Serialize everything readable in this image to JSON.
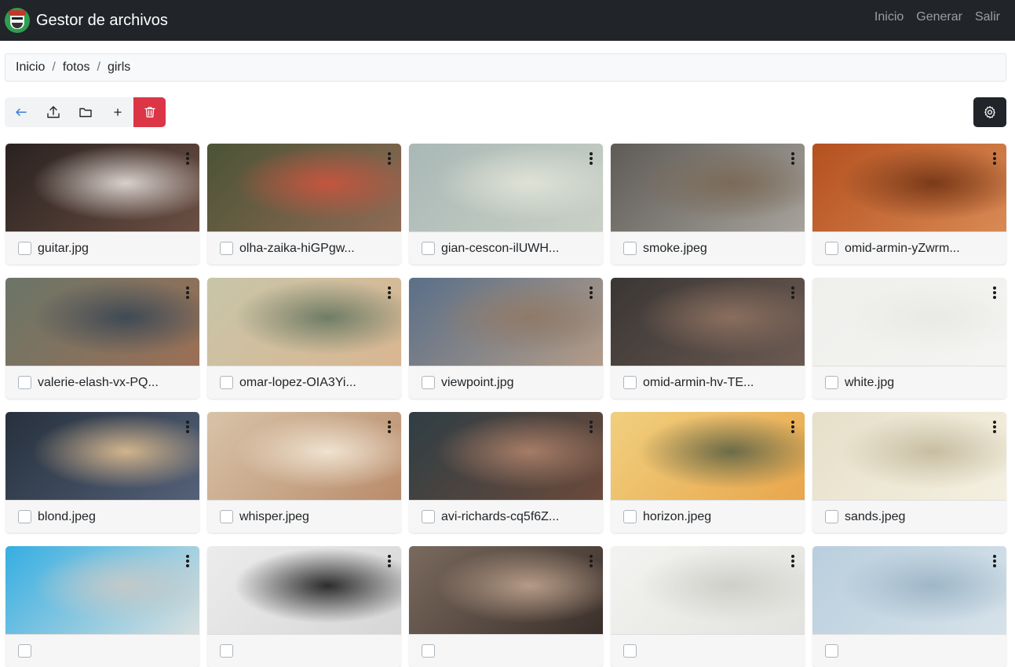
{
  "app": {
    "title": "Gestor de archivos"
  },
  "nav": {
    "links": [
      "Inicio",
      "Generar",
      "Salir"
    ]
  },
  "breadcrumb": [
    "Inicio",
    "fotos",
    "girls"
  ],
  "toolbar": {
    "buttons": [
      "back-arrow-icon",
      "upload-icon",
      "folder-icon",
      "plus-icon",
      "trash-icon"
    ],
    "settings": "gear-icon"
  },
  "files": [
    {
      "name": "guitar.jpg",
      "colors": [
        "#2a2220",
        "#6b4f43",
        "#d8d0cc"
      ]
    },
    {
      "name": "olha-zaika-hiGPgw...",
      "colors": [
        "#4b5336",
        "#8e6b55",
        "#c4553f"
      ]
    },
    {
      "name": "gian-cescon-ilUWH...",
      "colors": [
        "#a9b8b6",
        "#c9d0c6",
        "#dfe2d6"
      ]
    },
    {
      "name": "smoke.jpeg",
      "colors": [
        "#5e5a55",
        "#a7a39c",
        "#7b6a58"
      ]
    },
    {
      "name": "omid-armin-yZwrm...",
      "colors": [
        "#b4501f",
        "#d98a55",
        "#7a3a18"
      ]
    },
    {
      "name": "valerie-elash-vx-PQ...",
      "colors": [
        "#6a7568",
        "#9b6f55",
        "#3f4a55"
      ]
    },
    {
      "name": "omar-lopez-OIA3Yi...",
      "colors": [
        "#c8c5a9",
        "#d9b691",
        "#6f7d66"
      ]
    },
    {
      "name": "viewpoint.jpg",
      "colors": [
        "#5a6f88",
        "#b39c88",
        "#8f7a68"
      ]
    },
    {
      "name": "omid-armin-hv-TE...",
      "colors": [
        "#3a3634",
        "#6b5a52",
        "#8a6e5e"
      ]
    },
    {
      "name": "white.jpg",
      "colors": [
        "#efefec",
        "#f4f4f2",
        "#e9e9e6"
      ]
    },
    {
      "name": "blond.jpeg",
      "colors": [
        "#26303d",
        "#546178",
        "#d2b48c"
      ]
    },
    {
      "name": "whisper.jpeg",
      "colors": [
        "#d8c3a8",
        "#b98c6b",
        "#efe2d0"
      ]
    },
    {
      "name": "avi-richards-cq5f6Z...",
      "colors": [
        "#2f3e44",
        "#6b4a3b",
        "#a67c66"
      ]
    },
    {
      "name": "horizon.jpeg",
      "colors": [
        "#f1cf7e",
        "#e8a64c",
        "#6b6b48"
      ]
    },
    {
      "name": "sands.jpeg",
      "colors": [
        "#e6dfc9",
        "#f4f0e0",
        "#c8bda2"
      ]
    },
    {
      "name": "",
      "colors": [
        "#35aee2",
        "#d9e0df",
        "#c2c9c9"
      ]
    },
    {
      "name": "",
      "colors": [
        "#ececec",
        "#d6d6d6",
        "#2c2c2c"
      ]
    },
    {
      "name": "",
      "colors": [
        "#7a6a5e",
        "#3a2f2a",
        "#b69b87"
      ]
    },
    {
      "name": "",
      "colors": [
        "#f3f3f1",
        "#e2e2de",
        "#cfcfca"
      ]
    },
    {
      "name": "",
      "colors": [
        "#b9cedd",
        "#d6e2ea",
        "#9fb7c8"
      ]
    }
  ]
}
